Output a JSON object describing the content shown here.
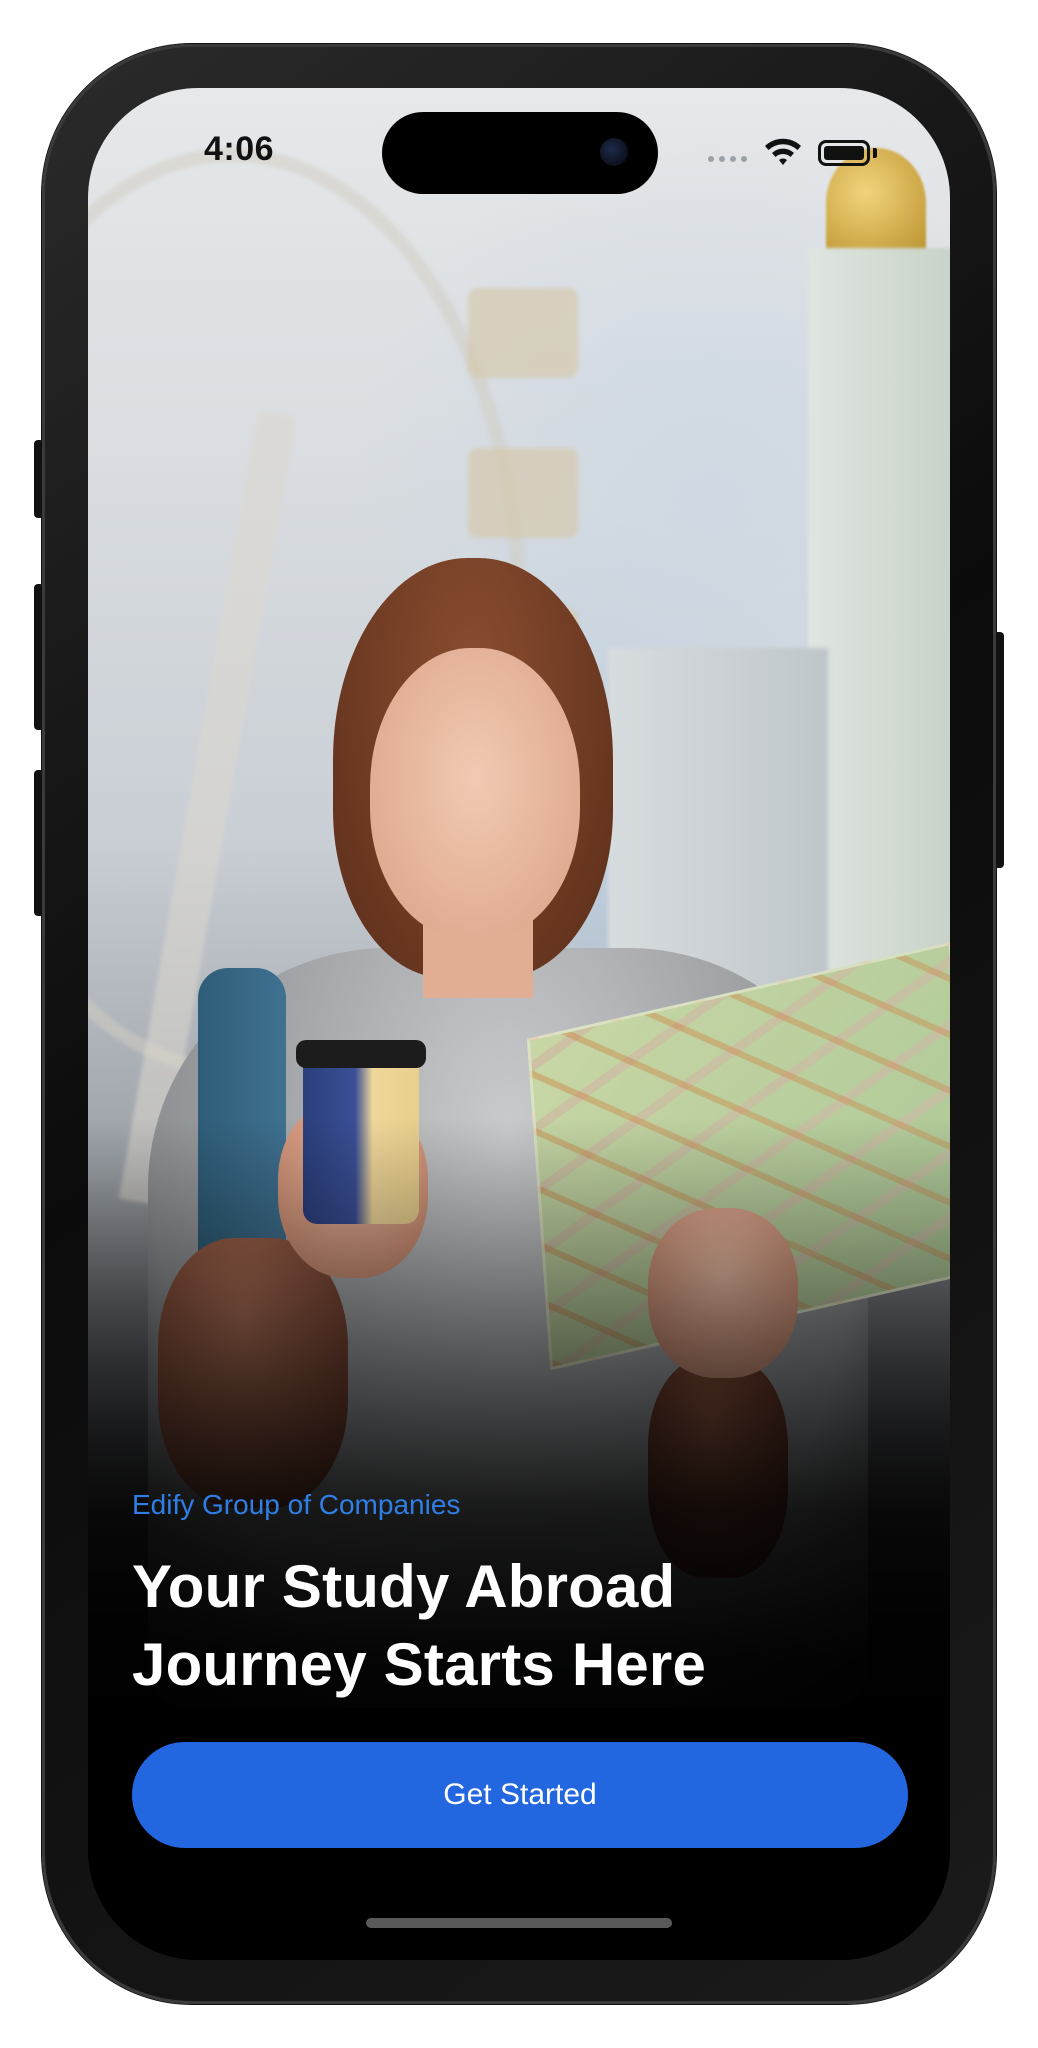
{
  "status_bar": {
    "time": "4:06",
    "icons": [
      "signal-dots-icon",
      "wifi-icon",
      "battery-icon"
    ]
  },
  "hero": {
    "brand": "Edify Group of Companies",
    "headline_line1": "Your Study Abroad",
    "headline_line2": "Journey Starts Here"
  },
  "cta": {
    "label": "Get Started"
  },
  "colors": {
    "brand_text": "#2f7ee6",
    "cta_background": "#2266e0",
    "headline_text": "#ffffff",
    "screen_background": "#000000"
  }
}
